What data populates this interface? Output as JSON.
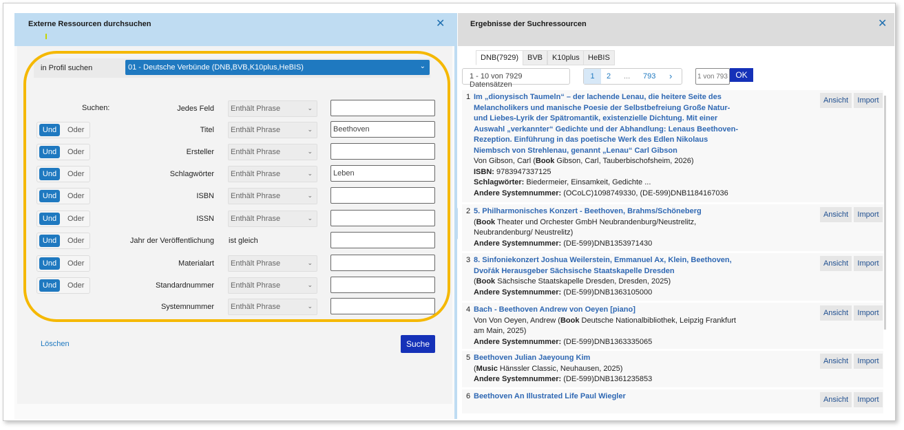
{
  "left": {
    "title": "Externe Ressourcen durchsuchen",
    "close": "✕",
    "profile_label": "in Profil suchen",
    "profile_value": "01 - Deutsche Verbünde (DNB,BVB,K10plus,HeBIS)",
    "search_label": "Suchen:",
    "und": "Und",
    "oder": "Oder",
    "operator_default": "Enthält Phrase",
    "fields": [
      {
        "label": "Jedes Feld",
        "operator": "Enthält Phrase",
        "value": "",
        "has_toggle": false
      },
      {
        "label": "Titel",
        "operator": "Enthält Phrase",
        "value": "Beethoven",
        "has_toggle": true
      },
      {
        "label": "Ersteller",
        "operator": "Enthält Phrase",
        "value": "",
        "has_toggle": true
      },
      {
        "label": "Schlagwörter",
        "operator": "Enthält Phrase",
        "value": "Leben",
        "has_toggle": true
      },
      {
        "label": "ISBN",
        "operator": "Enthält Phrase",
        "value": "",
        "has_toggle": true
      },
      {
        "label": "ISSN",
        "operator": "Enthält Phrase",
        "value": "",
        "has_toggle": true
      },
      {
        "label": "Jahr der Veröffentlichung",
        "operator": "ist gleich",
        "value": "",
        "has_toggle": true
      },
      {
        "label": "Materialart",
        "operator": "Enthält Phrase",
        "value": "",
        "has_toggle": true
      },
      {
        "label": "Standardnummer",
        "operator": "Enthält Phrase",
        "value": "",
        "has_toggle": true
      },
      {
        "label": "Systemnummer",
        "operator": "Enthält Phrase",
        "value": "",
        "has_toggle": false
      }
    ],
    "clear_label": "Löschen",
    "search_button": "Suche"
  },
  "right": {
    "title": "Ergebnisse der Suchressourcen",
    "close": "✕",
    "tabs": [
      "DNB(7929)",
      "BVB",
      "K10plus",
      "HeBIS"
    ],
    "count_text": "1 - 10 von 7929 Datensätzen",
    "pager": {
      "p1": "1",
      "p2": "2",
      "ellipsis": "...",
      "last": "793",
      "next": "›"
    },
    "page_input_placeholder": "1 von 793",
    "ok_label": "OK",
    "view_label": "Ansicht",
    "import_label": "Import",
    "results": [
      {
        "num": "1",
        "title": "Im „dionysisch Taumeln“ – der lachende Lenau, die heitere Seite des Melancholikers und manische Poesie der Selbstbefreiung Große Natur- und Liebes-Lyrik der Spätromantik, existenzielle Dichtung. Mit einer Auswahl „verkannter“ Gedichte und der Abhandlung: Lenaus Beethoven-Rezeption. Einführung in das poetische Werk des Edlen Nikolaus Niembsch von Strehlenau, genannt „Lenau“ Carl Gibson",
        "line1_pre": "Von Gibson, Carl (",
        "line1_bold": "Book",
        "line1_post": " Gibson, Carl, Tauberbischofsheim, 2026)",
        "extra": [
          {
            "k": "ISBN:",
            "v": " 9783947337125"
          },
          {
            "k": "Schlagwörter:",
            "v": " Biedermeier, Einsamkeit, Gedichte ..."
          },
          {
            "k": "Andere Systemnummer:",
            "v": " (OCoLC)1098749330, (DE-599)DNB1184167036"
          }
        ]
      },
      {
        "num": "2",
        "title": "5. Philharmonisches Konzert - Beethoven, Brahms/Schöneberg",
        "line1_pre": "(",
        "line1_bold": "Book",
        "line1_post": " Theater und Orchester GmbH Neubrandenburg/Neustrelitz, Neubrandenburg/ Neustrelitz)",
        "extra": [
          {
            "k": "Andere Systemnummer:",
            "v": " (DE-599)DNB1353971430"
          }
        ]
      },
      {
        "num": "3",
        "title": "8. Sinfoniekonzert Joshua Weilerstein, Emmanuel Ax, Klein, Beethoven, Dvořák Herausgeber Sächsische Staatskapelle Dresden",
        "line1_pre": "(",
        "line1_bold": "Book",
        "line1_post": " Sächsische Staatskapelle Dresden, Dresden, 2025)",
        "extra": [
          {
            "k": "Andere Systemnummer:",
            "v": " (DE-599)DNB1363105000"
          }
        ]
      },
      {
        "num": "4",
        "title": "Bach - Beethoven Andrew von Oeyen [piano]",
        "line1_pre": "Von Von Oeyen, Andrew (",
        "line1_bold": "Book",
        "line1_post": " Deutsche Nationalbibliothek, Leipzig Frankfurt am Main, 2025)",
        "extra": [
          {
            "k": "Andere Systemnummer:",
            "v": " (DE-599)DNB1363335065"
          }
        ]
      },
      {
        "num": "5",
        "title": "Beethoven Julian Jaeyoung Kim",
        "line1_pre": "(",
        "line1_bold": "Music",
        "line1_post": " Hänssler Classic, Neuhausen, 2025)",
        "extra": [
          {
            "k": "Andere Systemnummer:",
            "v": " (DE-599)DNB1361235853"
          }
        ]
      },
      {
        "num": "6",
        "title": "Beethoven An Illustrated Life Paul Wiegler",
        "line1_pre": "",
        "line1_bold": "",
        "line1_post": "",
        "extra": []
      }
    ]
  }
}
